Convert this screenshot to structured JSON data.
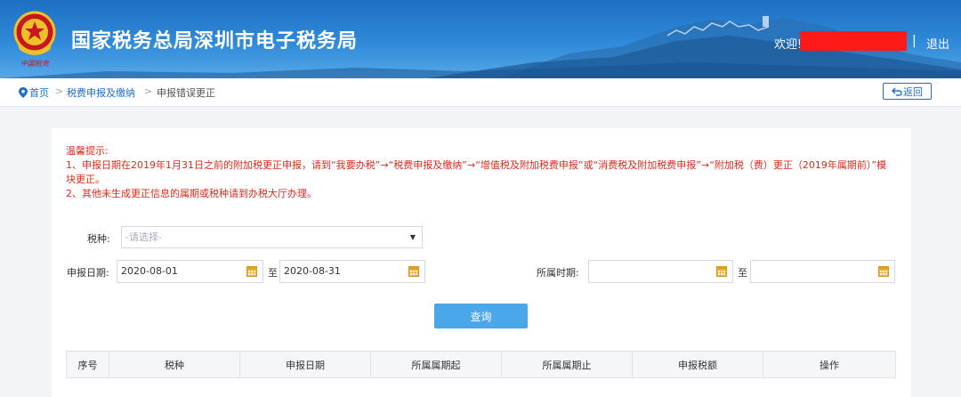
{
  "header": {
    "title": "国家税务总局深圳市电子税务局",
    "emblem_caption": "中国税务",
    "welcome": "欢迎!",
    "separator": "|",
    "logout": "退出"
  },
  "breadcrumb": {
    "home": "首页",
    "separator": ">",
    "item2": "税费申报及缴纳",
    "item3": "申报错误更正",
    "back": "返回"
  },
  "notice": {
    "title": "温馨提示:",
    "line1": "1、申报日期在2019年1月31日之前的附加税更正申报，请到“我要办税”→“税费申报及缴纳”→“增值税及附加税费申报”或“消费税及附加税费申报”→“附加税（费）更正（2019年属期前）”模块更正。",
    "line2": "2、其他未生成更正信息的属期或税种请到办税大厅办理。"
  },
  "form": {
    "tax_type_label": "税种:",
    "tax_type_placeholder": "-请选择-",
    "declare_date_label": "申报日期:",
    "declare_date_from": "2020-08-01",
    "declare_date_to": "2020-08-31",
    "to_label": "至",
    "period_label": "所属时期:",
    "period_from": "",
    "period_to": "",
    "query_button": "查询"
  },
  "table": {
    "columns": [
      "序号",
      "税种",
      "申报日期",
      "所属属期起",
      "所属属期止",
      "申报税额",
      "操作"
    ]
  },
  "colors": {
    "accent": "#1a6fd0",
    "notice": "#e0291d",
    "query_button": "#4aa8ea",
    "redaction": "#ff1a1a"
  },
  "icons": [
    "location-pin-icon",
    "back-arrow-icon",
    "calendar-icon",
    "chevron-down-icon",
    "tax-emblem-icon"
  ]
}
